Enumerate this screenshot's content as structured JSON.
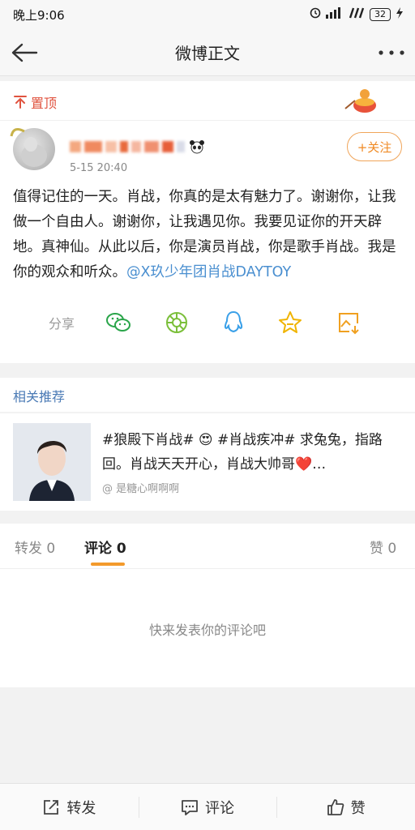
{
  "status_bar": {
    "time": "晚上9:06",
    "battery": "32"
  },
  "nav": {
    "title": "微博正文"
  },
  "post": {
    "pinned_label": "置顶",
    "time": "5-15 20:40",
    "follow_label": "+关注",
    "text": "值得记住的一天。肖战，你真的是太有魅力了。谢谢你，让我做一个自由人。谢谢你，让我遇见你。我要见证你的开天辟地。真神仙。从此以后，你是演员肖战，你是歌手肖战。我是你的观众和听众。",
    "mention": "@X玖少年团肖战DAYTOY",
    "share_label": "分享"
  },
  "recommend": {
    "header": "相关推荐",
    "text": "#狼殿下肖战# 😍 #肖战疾冲# 求兔兔，指路回。肖战天天开心，肖战大帅哥❤️…",
    "author": "@ 是糖心啊啊啊"
  },
  "tabs": {
    "repost": "转发 0",
    "comment": "评论 0",
    "like": "赞 0"
  },
  "comments_empty": "快来发表你的评论吧",
  "bottom_bar": {
    "repost": "转发",
    "comment": "评论",
    "like": "赞"
  },
  "colors": {
    "accent_orange": "#f39a2b",
    "link_blue": "#4a8fd0",
    "pin_red": "#e0533f"
  }
}
